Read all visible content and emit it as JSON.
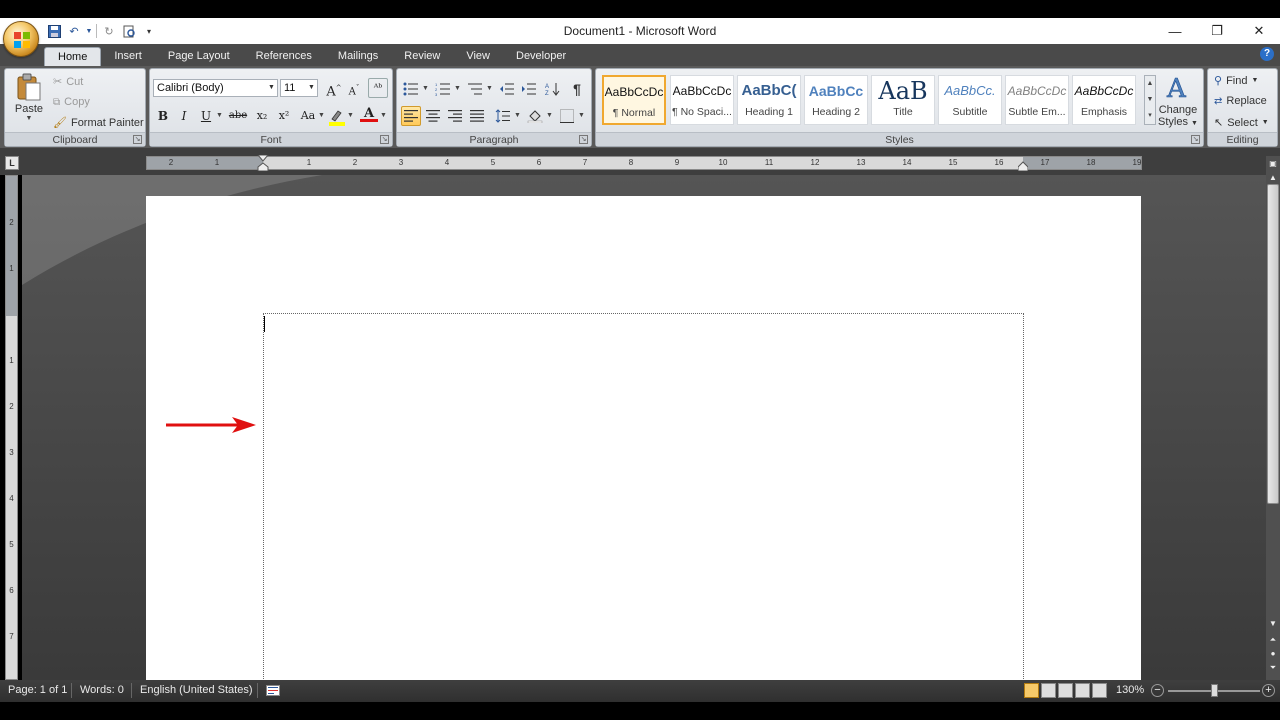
{
  "window": {
    "title": "Document1 - Microsoft Word",
    "controls": {
      "minimize": "—",
      "restore": "❐",
      "close": "✕"
    }
  },
  "tabs": [
    "Home",
    "Insert",
    "Page Layout",
    "References",
    "Mailings",
    "Review",
    "View",
    "Developer"
  ],
  "active_tab": "Home",
  "ribbon": {
    "clipboard": {
      "label": "Clipboard",
      "paste": "Paste",
      "cut": "Cut",
      "copy": "Copy",
      "format_painter": "Format Painter"
    },
    "font": {
      "label": "Font",
      "font_name": "Calibri (Body)",
      "font_size": "11",
      "grow": "A",
      "shrink": "A",
      "bold": "B",
      "italic": "I",
      "underline": "U",
      "strike": "abe",
      "subscript": "x₂",
      "superscript": "x²",
      "change_case": "Aa",
      "font_color": "A"
    },
    "paragraph": {
      "label": "Paragraph",
      "show_marks": "¶"
    },
    "styles": {
      "label": "Styles",
      "items": [
        {
          "sample": "AaBbCcDc",
          "name": "¶ Normal"
        },
        {
          "sample": "AaBbCcDc",
          "name": "¶ No Spaci..."
        },
        {
          "sample": "AaBbC(",
          "name": "Heading 1"
        },
        {
          "sample": "AaBbCc",
          "name": "Heading 2"
        },
        {
          "sample": "AaB",
          "name": "Title"
        },
        {
          "sample": "AaBbCc.",
          "name": "Subtitle"
        },
        {
          "sample": "AaBbCcDc",
          "name": "Subtle Em..."
        },
        {
          "sample": "AaBbCcDc",
          "name": "Emphasis"
        }
      ],
      "change_styles_line1": "Change",
      "change_styles_line2": "Styles"
    },
    "editing": {
      "label": "Editing",
      "find": "Find",
      "replace": "Replace",
      "select": "Select"
    }
  },
  "ruler": {
    "corner": "L",
    "ticks": [
      "2",
      "1",
      "1",
      "2",
      "3",
      "4",
      "5",
      "6",
      "7",
      "8",
      "9",
      "10",
      "11",
      "12",
      "13",
      "14",
      "15",
      "16",
      "17",
      "18",
      "19"
    ],
    "vticks": [
      "2",
      "1",
      "1",
      "2",
      "3",
      "4",
      "5",
      "6",
      "7"
    ]
  },
  "status": {
    "page": "Page: 1 of 1",
    "words": "Words: 0",
    "language": "English (United States)",
    "zoom": "130%",
    "zoom_out": "−",
    "zoom_in": "+"
  },
  "colors": {
    "arrow": "#e01010",
    "accent": "#2b579a"
  }
}
